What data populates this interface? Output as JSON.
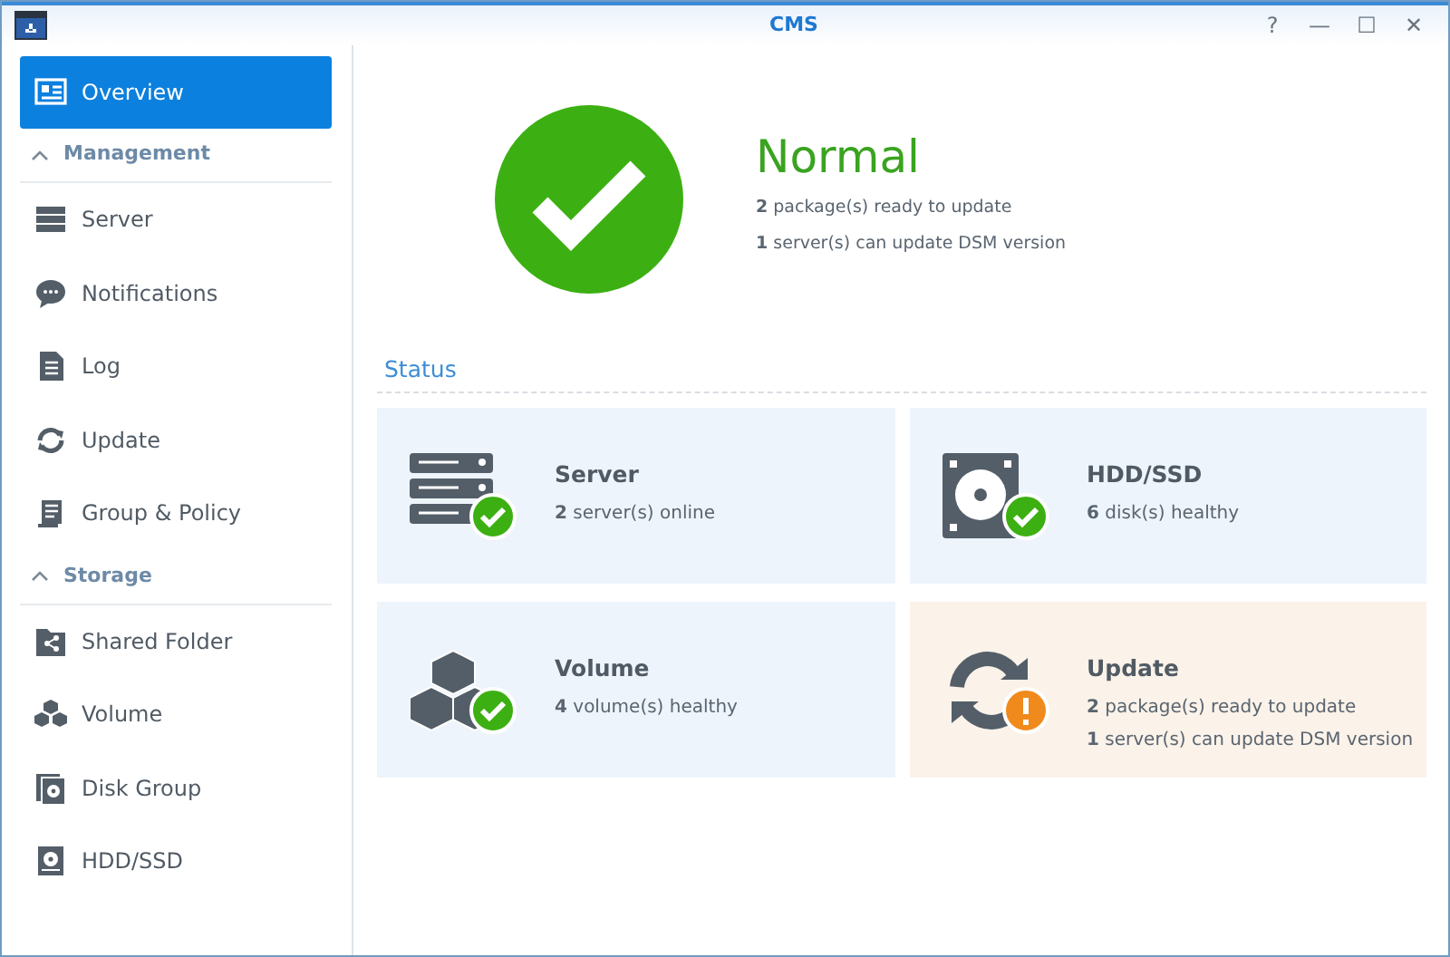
{
  "window": {
    "title": "CMS",
    "controls": [
      "?",
      "—",
      "☐",
      "✕"
    ]
  },
  "sidebar": {
    "items": [
      {
        "kind": "item",
        "label": "Overview",
        "selected": true
      },
      {
        "kind": "section",
        "label": "Management",
        "expanded": true
      },
      {
        "kind": "item",
        "label": "Server",
        "selected": false
      },
      {
        "kind": "item",
        "label": "Notifications",
        "selected": false
      },
      {
        "kind": "item",
        "label": "Log",
        "selected": false
      },
      {
        "kind": "item",
        "label": "Update",
        "selected": false
      },
      {
        "kind": "item",
        "label": "Group & Policy",
        "selected": false
      },
      {
        "kind": "section",
        "label": "Storage",
        "expanded": true
      },
      {
        "kind": "item",
        "label": "Shared Folder",
        "selected": false
      },
      {
        "kind": "item",
        "label": "Volume",
        "selected": false
      },
      {
        "kind": "item",
        "label": "Disk Group",
        "selected": false
      },
      {
        "kind": "item",
        "label": "HDD/SSD",
        "selected": false
      }
    ]
  },
  "summary": {
    "warning": false,
    "title": "Normal",
    "lines": [
      "**2** package(s) ready to update",
      "**1** server(s) can update DSM version"
    ]
  },
  "status_section": {
    "title": "Status",
    "cards": [
      {
        "title": "Server",
        "warning": false,
        "lines": [
          "**2** server(s) online"
        ]
      },
      {
        "title": "HDD/SSD",
        "warning": false,
        "lines": [
          "**6** disk(s) healthy"
        ]
      },
      {
        "title": "Volume",
        "warning": false,
        "lines": [
          "**4** volume(s) healthy"
        ]
      },
      {
        "title": "Update",
        "warning": true,
        "lines": [
          "**2** package(s) ready to update",
          "**1** server(s) can update DSM version"
        ]
      }
    ]
  }
}
